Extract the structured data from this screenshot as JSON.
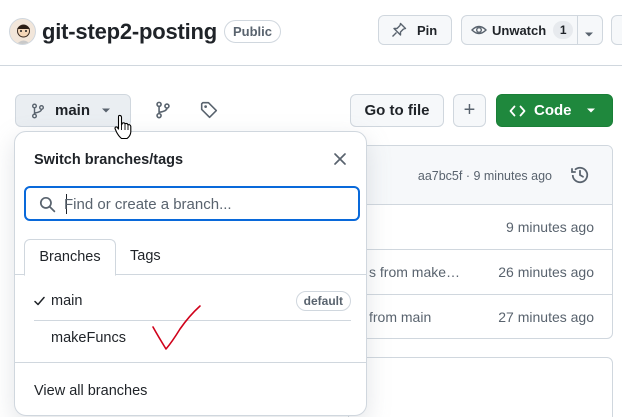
{
  "repo": {
    "name": "git-step2-posting",
    "visibility": "Public",
    "pin_label": "Pin",
    "unwatch_label": "Unwatch",
    "watch_count": "1"
  },
  "toolbar": {
    "branch_label": "main",
    "goto_label": "Go to file",
    "add_label": "+",
    "code_label": "Code"
  },
  "files": {
    "commit_hash": "aa7bc5f",
    "commit_time": "9 minutes ago",
    "rows": [
      {
        "message": "",
        "time": "9 minutes ago"
      },
      {
        "message": "s from make…",
        "time": "26 minutes ago"
      },
      {
        "message": "from main",
        "time": "27 minutes ago"
      }
    ]
  },
  "dropdown": {
    "title": "Switch branches/tags",
    "search_placeholder": "Find or create a branch...",
    "tabs": [
      "Branches",
      "Tags"
    ],
    "branches": [
      {
        "name": "main",
        "selected": true,
        "badge": "default"
      },
      {
        "name": "makeFuncs",
        "selected": false,
        "badge": ""
      }
    ],
    "footer_link": "View all branches"
  },
  "colors": {
    "accent": "#0969da",
    "primary_button": "#1f883d",
    "annotation": "#d0021b",
    "border": "#d0d7de",
    "muted_text": "#59636e"
  },
  "icons": [
    "avatar",
    "pin-icon",
    "eye-icon",
    "caret-down-icon",
    "git-branch-icon",
    "branches-icon",
    "tag-icon",
    "code-icon",
    "history-icon",
    "close-icon",
    "search-icon",
    "check-icon",
    "hand-cursor-icon"
  ]
}
